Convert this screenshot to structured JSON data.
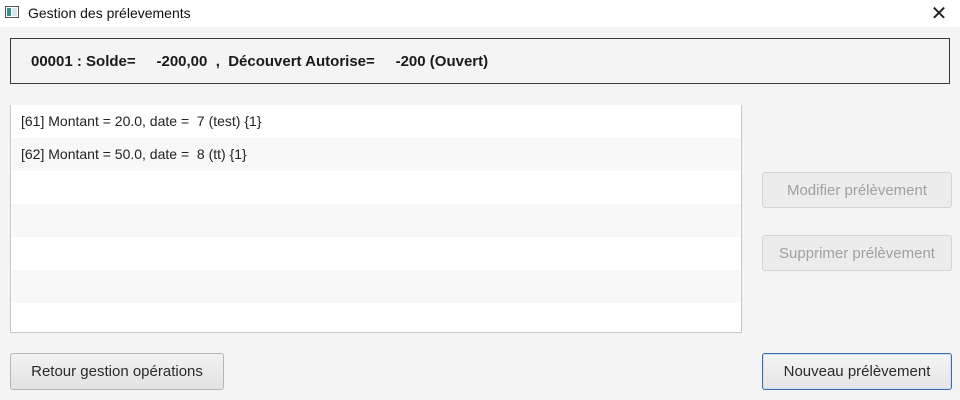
{
  "window": {
    "title": "Gestion des prélevements",
    "close_glyph": "✕"
  },
  "account": {
    "summary": "00001 : Solde=     -200,00  ,  Découvert Autorise=     -200 (Ouvert)"
  },
  "list": {
    "items": [
      "[61] Montant = 20.0, date =  7 (test) {1}",
      "[62] Montant = 50.0, date =  8 (tt) {1}",
      "",
      "",
      "",
      "",
      ""
    ]
  },
  "buttons": {
    "modify": {
      "label": "Modifier prélèvement",
      "enabled": false
    },
    "delete": {
      "label": "Supprimer prélèvement",
      "enabled": false
    },
    "back": {
      "label": "Retour gestion opérations"
    },
    "new": {
      "label": "Nouveau prélèvement"
    }
  },
  "colors": {
    "background": "#f4f4f4",
    "default_button_border": "#3b6ea8"
  }
}
